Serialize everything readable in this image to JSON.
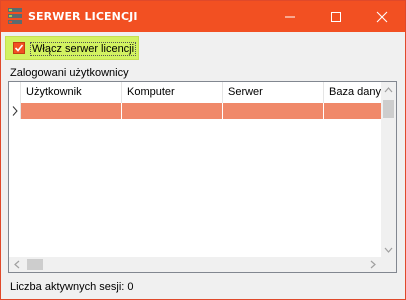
{
  "window": {
    "title": "SERWER LICENCJI",
    "accent_color": "#f25022",
    "icons": {
      "app": "server-app-icon",
      "minimize": "minimize-icon",
      "maximize": "maximize-icon",
      "close": "close-icon"
    }
  },
  "toggle": {
    "label": "Włącz serwer licencji",
    "checked": true,
    "highlight_color": "#d2f261"
  },
  "users": {
    "section_label": "Zalogowani użytkownicy",
    "columns": [
      "Użytkownik",
      "Komputer",
      "Serwer",
      "Baza danych"
    ],
    "rows": [
      [
        "",
        "",
        "",
        ""
      ]
    ],
    "row_color": "#f0896a"
  },
  "status": {
    "text": "Liczba aktywnych sesji: 0"
  }
}
